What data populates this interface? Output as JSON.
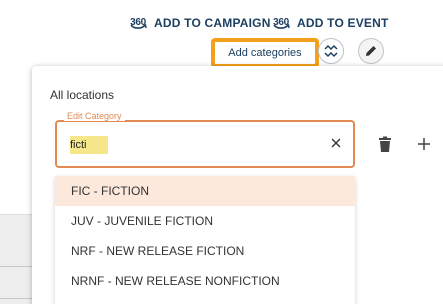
{
  "header": {
    "campaign_icon_text": "360",
    "campaign_label": "ADD TO CAMPAIGN",
    "event_icon_text": "360",
    "event_label": "ADD TO EVENT",
    "add_categories_label": "Add categories"
  },
  "icons": {
    "campaign": "360-icon",
    "event": "360-icon",
    "swap": "swap-icon",
    "edit": "pencil-icon",
    "clear": "close-icon",
    "delete": "trash-icon",
    "add": "plus-icon"
  },
  "colors": {
    "brand_navy": "#1d3f61",
    "highlight_orange": "#f5a01a",
    "field_border": "#e38a52",
    "search_highlight": "#f5e78a",
    "selected_option": "#fde8dc"
  },
  "modal": {
    "title": "All locations",
    "field": {
      "label": "Edit Category",
      "value": "ficti"
    },
    "options": [
      {
        "label": "FIC - FICTION"
      },
      {
        "label": "JUV - JUVENILE FICTION"
      },
      {
        "label": "NRF - NEW RELEASE FICTION"
      },
      {
        "label": "NRNF - NEW RELEASE NONFICTION"
      }
    ]
  }
}
